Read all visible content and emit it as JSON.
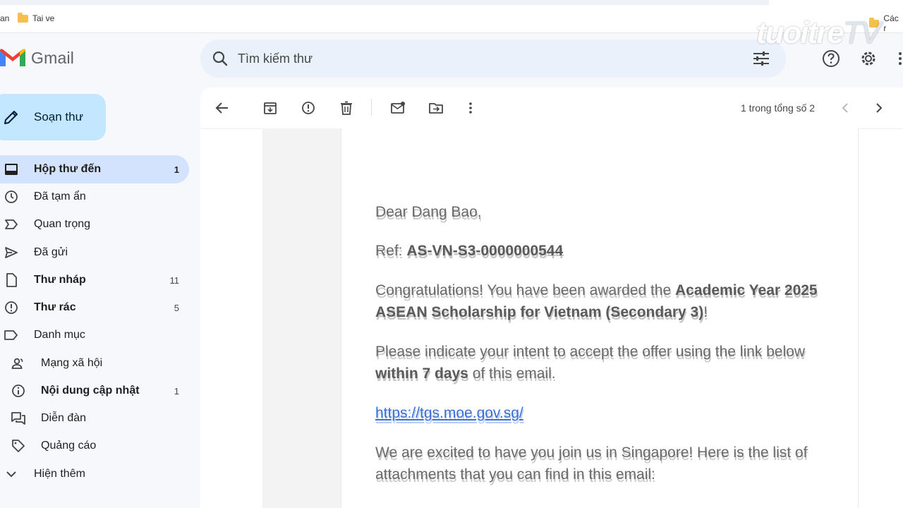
{
  "bookmarks": {
    "left_fragment": "an",
    "tai_ve": "Tai ve",
    "right_fragment": "Các r"
  },
  "app": {
    "name": "Gmail"
  },
  "search": {
    "placeholder": "Tìm kiếm thư"
  },
  "watermark": {
    "main": "tuoitre",
    "suffix": "TV"
  },
  "compose": {
    "label": "Soạn thư"
  },
  "sidebar": {
    "items": [
      {
        "label": "Hộp thư đến",
        "count": "1",
        "icon": "inbox-icon"
      },
      {
        "label": "Đã tạm ẩn",
        "count": "",
        "icon": "clock-icon"
      },
      {
        "label": "Quan trọng",
        "count": "",
        "icon": "label-important-icon"
      },
      {
        "label": "Đã gửi",
        "count": "",
        "icon": "send-icon"
      },
      {
        "label": "Thư nháp",
        "count": "11",
        "icon": "draft-icon"
      },
      {
        "label": "Thư rác",
        "count": "5",
        "icon": "spam-icon"
      },
      {
        "label": "Danh mục",
        "count": "",
        "icon": "category-icon"
      },
      {
        "label": "Mạng xã hội",
        "count": "",
        "icon": "people-icon"
      },
      {
        "label": "Nội dung cập nhật",
        "count": "1",
        "icon": "info-icon"
      },
      {
        "label": "Diễn đàn",
        "count": "",
        "icon": "forum-icon"
      },
      {
        "label": "Quảng cáo",
        "count": "",
        "icon": "tag-icon"
      },
      {
        "label": "Hiện thêm",
        "count": "",
        "icon": "chevron-down-icon"
      }
    ]
  },
  "toolbar": {
    "pager": "1 trong tổng số 2"
  },
  "email": {
    "greeting": "Dear Dang Bao,",
    "ref_label": "Ref: ",
    "ref_value": "AS-VN-S3-0000000544",
    "congrats_prefix": "Congratulations! You have been awarded the ",
    "scholarship": "Academic Year 2025 ASEAN Scholarship for Vietnam (Secondary 3)",
    "congrats_suffix": "!",
    "intent_prefix": "Please indicate your intent to accept the offer using the link below ",
    "intent_bold": "within 7 days",
    "intent_suffix": " of this email.",
    "link": "https://tgs.moe.gov.sg/",
    "excited": "We are excited to have you join us in Singapore! Here is the list of attachments that you can find in this email:"
  },
  "colors": {
    "compose_bg": "#c2e7ff",
    "active_nav": "#d3e3fd",
    "search_bg": "#eaf1fb",
    "link": "#3a6fd8"
  }
}
